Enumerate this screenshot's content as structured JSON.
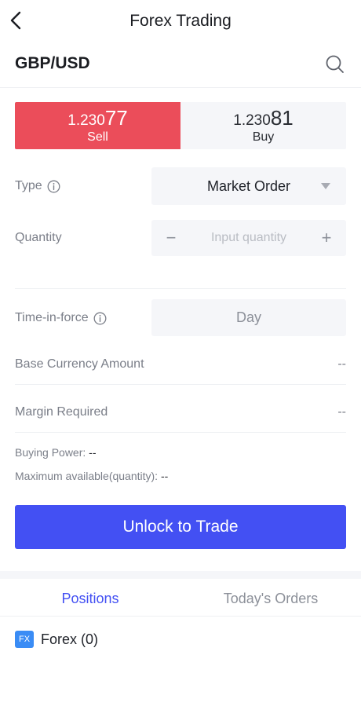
{
  "header": {
    "title": "Forex Trading"
  },
  "symbol": {
    "name": "GBP/USD"
  },
  "prices": {
    "sell": {
      "price_prefix": "1.230",
      "price_suffix": "77",
      "label": "Sell"
    },
    "buy": {
      "price_prefix": "1.230",
      "price_suffix": "81",
      "label": "Buy"
    }
  },
  "form": {
    "type": {
      "label": "Type",
      "value": "Market Order"
    },
    "quantity": {
      "label": "Quantity",
      "placeholder": "Input quantity",
      "minus": "−",
      "plus": "+"
    },
    "time_in_force": {
      "label": "Time-in-force",
      "value": "Day"
    },
    "base_currency_amount": {
      "label": "Base Currency Amount",
      "value": "--"
    },
    "margin_required": {
      "label": "Margin Required",
      "value": "--"
    },
    "buying_power": {
      "label": "Buying Power:",
      "value": "--"
    },
    "max_available": {
      "label": "Maximum available(quantity):",
      "value": "--"
    }
  },
  "actions": {
    "trade_button": "Unlock to Trade"
  },
  "tabs": [
    {
      "label": "Positions",
      "active": true
    },
    {
      "label": "Today's Orders",
      "active": false
    }
  ],
  "positions": {
    "group_icon": "FX",
    "group_label": "Forex (0)"
  },
  "icons": {
    "back": "chevron-left-icon",
    "search": "search-icon",
    "info": "info-icon",
    "caret": "caret-down-icon",
    "fx": "fx-badge-icon"
  },
  "colors": {
    "sell": "#eb4d5a",
    "buy_bg": "#f5f6f9",
    "accent": "#4350f3",
    "fx_badge": "#3a8cf5"
  }
}
